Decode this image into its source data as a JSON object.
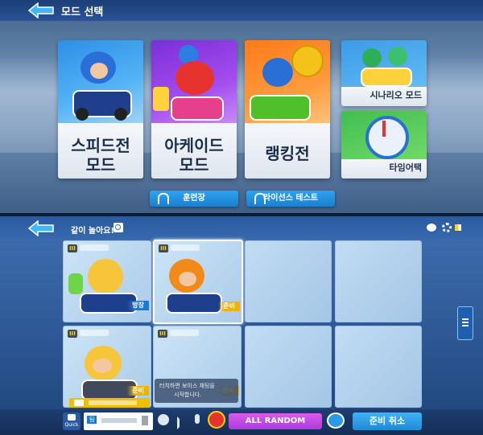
{
  "top_screen": {
    "title": "모드 선택",
    "modes": [
      {
        "label_line1": "스피드전",
        "label_line2": "모드"
      },
      {
        "label_line1": "아케이드",
        "label_line2": "모드"
      },
      {
        "label_line1": "랭킹전",
        "label_line2": ""
      }
    ],
    "side_modes": [
      {
        "label": "시나리오 모드"
      },
      {
        "label": "타임어택"
      }
    ],
    "buttons": {
      "training": "훈련장",
      "license": "라이선스 테스트"
    }
  },
  "bottom_screen": {
    "room_title": "같이 놀아요!",
    "slots": [
      {
        "status": "방장",
        "status_color": "blue",
        "has_player": true
      },
      {
        "status": "준비",
        "status_color": "gold",
        "has_player": true,
        "selected": true
      },
      {
        "has_player": false
      },
      {
        "has_player": false
      },
      {
        "status": "준비",
        "status_color": "gold",
        "has_player": true
      },
      {
        "status": "준비",
        "status_color": "gold",
        "has_player": false,
        "partial": true
      },
      {
        "has_player": false
      },
      {
        "has_player": false
      }
    ],
    "tooltip_line1": "터치하면 보이스 채팅을",
    "tooltip_line2": "시작합니다.",
    "chat": {
      "quick_label": "Quick",
      "channel_label": "팀"
    },
    "buttons": {
      "all_random": "ALL RANDOM",
      "cancel_ready": "준비 취소"
    },
    "colors": {
      "gold": "#f0b400",
      "blue": "#1a78d8",
      "all_random_bg": "#c63fe0",
      "cancel_bg": "#2a9ae8"
    }
  }
}
